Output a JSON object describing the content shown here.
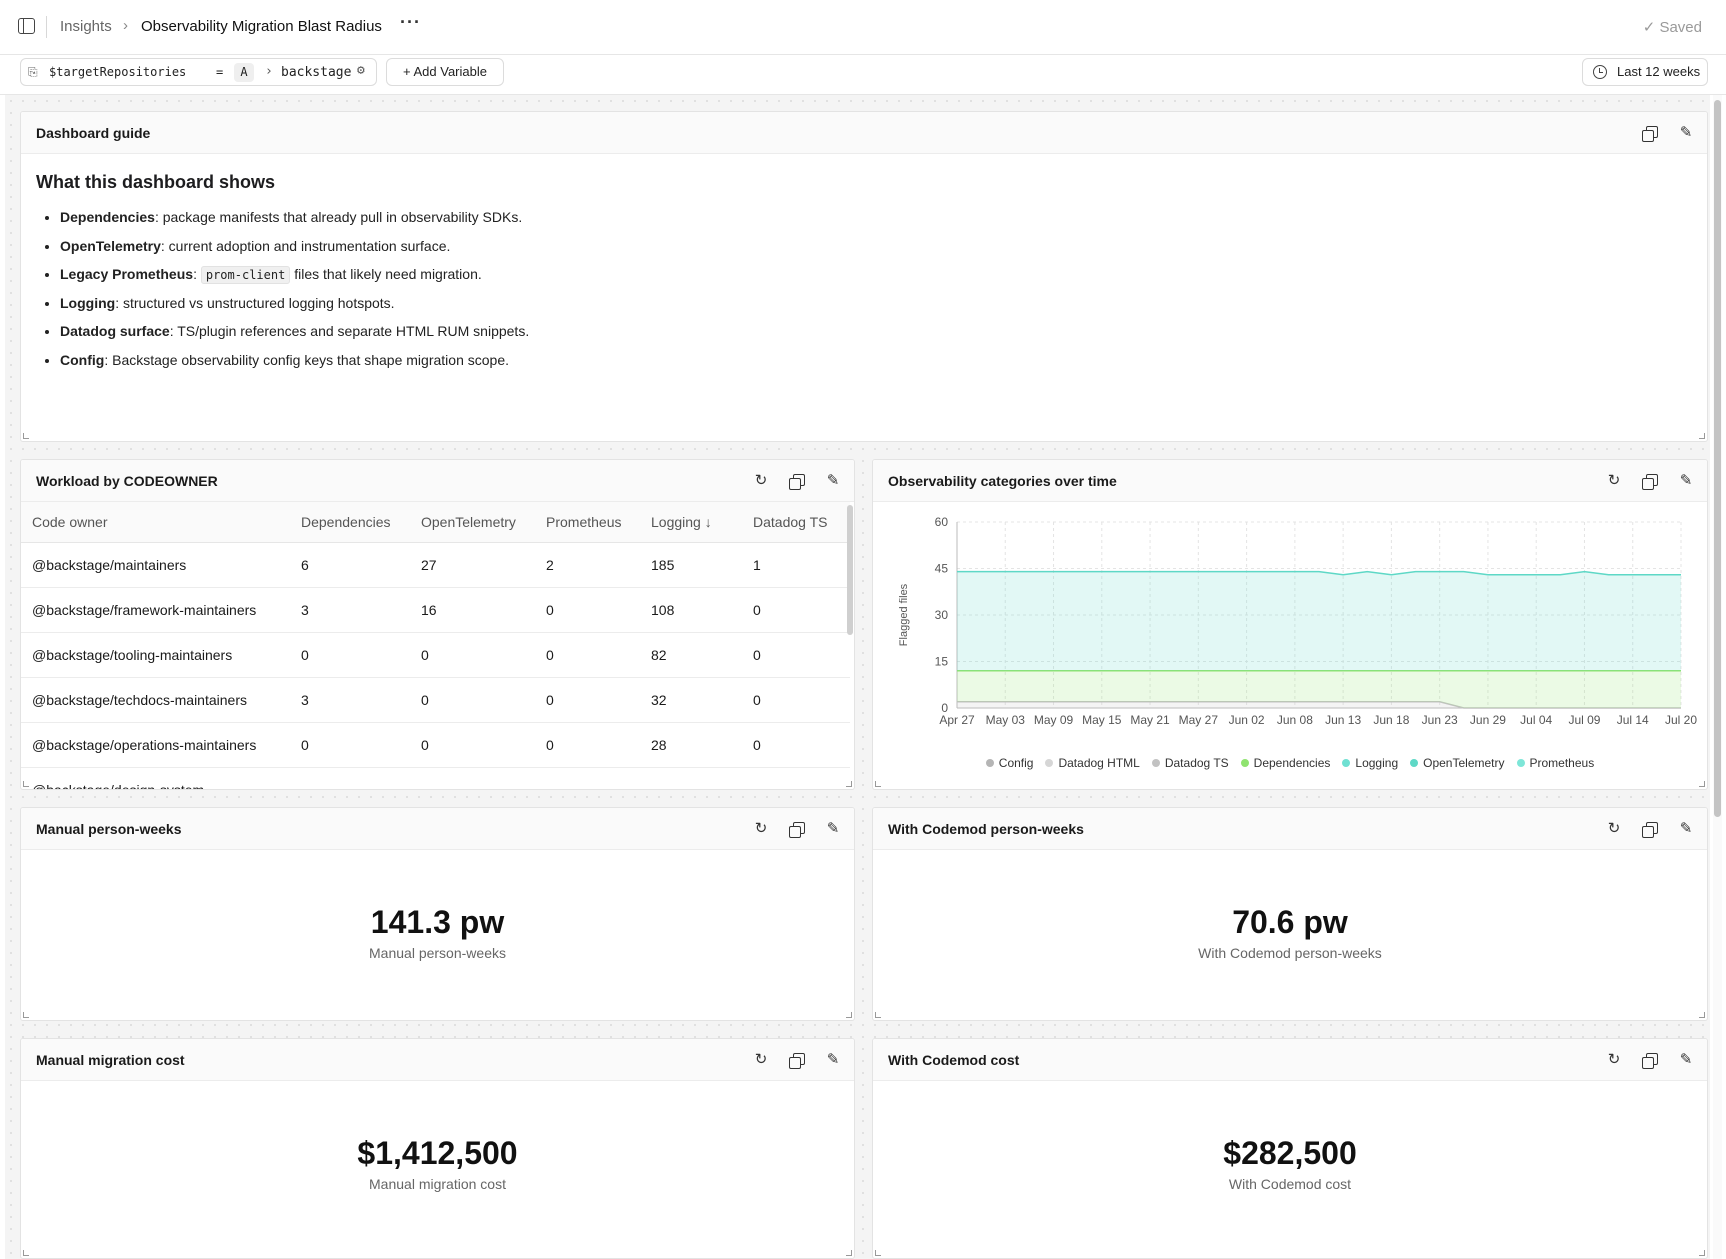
{
  "header": {
    "breadcrumb_root": "Insights",
    "breadcrumb_sep": "›",
    "title": "Observability Migration Blast Radius",
    "more": "···",
    "saved": "✓ Saved"
  },
  "variables": {
    "name": "$targetRepositories",
    "operator": "=",
    "mode": "A",
    "arrow": "›",
    "value": "backstage",
    "add_label": "+ Add Variable",
    "time_range": "Last 12 weeks"
  },
  "guide": {
    "title": "Dashboard guide",
    "heading": "What this dashboard shows",
    "items": [
      {
        "bold": "Dependencies",
        "pre": "",
        "code": "",
        "text": ": package manifests that already pull in observability SDKs."
      },
      {
        "bold": "OpenTelemetry",
        "pre": "",
        "code": "",
        "text": ": current adoption and instrumentation surface."
      },
      {
        "bold": "Legacy Prometheus",
        "pre": ": ",
        "code": "prom-client",
        "text": " files that likely need migration."
      },
      {
        "bold": "Logging",
        "pre": "",
        "code": "",
        "text": ": structured vs unstructured logging hotspots."
      },
      {
        "bold": "Datadog surface",
        "pre": "",
        "code": "",
        "text": ": TS/plugin references and separate HTML RUM snippets."
      },
      {
        "bold": "Config",
        "pre": "",
        "code": "",
        "text": ": Backstage observability config keys that shape migration scope."
      }
    ]
  },
  "workload": {
    "title": "Workload by CODEOWNER",
    "columns": [
      "Code owner",
      "Dependencies",
      "OpenTelemetry",
      "Prometheus",
      "Logging ↓",
      "Datadog TS"
    ],
    "rows": [
      [
        "@backstage/maintainers",
        "6",
        "27",
        "2",
        "185",
        "1"
      ],
      [
        "@backstage/framework-maintainers",
        "3",
        "16",
        "0",
        "108",
        "0"
      ],
      [
        "@backstage/tooling-maintainers",
        "0",
        "0",
        "0",
        "82",
        "0"
      ],
      [
        "@backstage/techdocs-maintainers",
        "3",
        "0",
        "0",
        "32",
        "0"
      ],
      [
        "@backstage/operations-maintainers",
        "0",
        "0",
        "0",
        "28",
        "0"
      ],
      [
        "@backstage/design-system",
        "",
        "",
        "",
        "",
        ""
      ]
    ]
  },
  "chart_card": {
    "title": "Observability categories over time"
  },
  "chart_data": {
    "type": "area",
    "stacked": true,
    "ylabel": "Flagged files",
    "ylim": [
      0,
      60
    ],
    "yticks": [
      0,
      15,
      30,
      45,
      60
    ],
    "x": [
      "Apr 27",
      "Apr 30",
      "May 03",
      "May 06",
      "May 09",
      "May 12",
      "May 15",
      "May 18",
      "May 21",
      "May 24",
      "May 27",
      "May 30",
      "Jun 02",
      "Jun 05",
      "Jun 08",
      "Jun 11",
      "Jun 13",
      "Jun 16",
      "Jun 18",
      "Jun 21",
      "Jun 23",
      "Jun 26",
      "Jun 29",
      "Jul 02",
      "Jul 04",
      "Jul 07",
      "Jul 09",
      "Jul 12",
      "Jul 14",
      "Jul 17",
      "Jul 20"
    ],
    "xtick_labels": [
      "Apr 27",
      "May 03",
      "May 09",
      "May 15",
      "May 21",
      "May 27",
      "Jun 02",
      "Jun 08",
      "Jun 13",
      "Jun 18",
      "Jun 23",
      "Jun 29",
      "Jul 04",
      "Jul 09",
      "Jul 14",
      "Jul 20"
    ],
    "grid": true,
    "legend_position": "bottom",
    "series": [
      {
        "name": "Config",
        "color": "#b5b5b5",
        "values": [
          0,
          0,
          0,
          0,
          0,
          0,
          0,
          0,
          0,
          0,
          0,
          0,
          0,
          0,
          0,
          0,
          0,
          0,
          0,
          0,
          0,
          0,
          0,
          0,
          0,
          0,
          0,
          0,
          0,
          0,
          0
        ]
      },
      {
        "name": "Datadog HTML",
        "color": "#d6d6d6",
        "values": [
          0,
          0,
          0,
          0,
          0,
          0,
          0,
          0,
          0,
          0,
          0,
          0,
          0,
          0,
          0,
          0,
          0,
          0,
          0,
          0,
          0,
          0,
          0,
          0,
          0,
          0,
          0,
          0,
          0,
          0,
          0
        ]
      },
      {
        "name": "Datadog TS",
        "color": "#c2c2c2",
        "values": [
          2,
          2,
          2,
          2,
          2,
          2,
          2,
          2,
          2,
          2,
          2,
          2,
          2,
          2,
          2,
          2,
          2,
          2,
          2,
          2,
          2,
          0,
          0,
          0,
          0,
          0,
          0,
          0,
          0,
          0,
          0
        ]
      },
      {
        "name": "Dependencies",
        "color": "#8fe36f",
        "values": [
          10,
          10,
          10,
          10,
          10,
          10,
          10,
          10,
          10,
          10,
          10,
          10,
          10,
          10,
          10,
          10,
          10,
          10,
          10,
          10,
          10,
          12,
          12,
          12,
          12,
          12,
          12,
          12,
          12,
          12,
          12
        ]
      },
      {
        "name": "Logging",
        "color": "#6fe0d2",
        "values": [
          0,
          0,
          0,
          0,
          0,
          0,
          0,
          0,
          0,
          0,
          0,
          0,
          0,
          0,
          0,
          0,
          0,
          0,
          0,
          0,
          0,
          0,
          0,
          0,
          0,
          0,
          0,
          0,
          0,
          0,
          0
        ]
      },
      {
        "name": "OpenTelemetry",
        "color": "#5ed8c6",
        "values": [
          32,
          32,
          32,
          32,
          32,
          32,
          32,
          32,
          32,
          32,
          32,
          32,
          32,
          32,
          32,
          32,
          31,
          32,
          31,
          32,
          32,
          32,
          31,
          31,
          31,
          31,
          32,
          31,
          31,
          31,
          31
        ]
      },
      {
        "name": "Prometheus",
        "color": "#7ee6d8",
        "values": [
          0,
          0,
          0,
          0,
          0,
          0,
          0,
          0,
          0,
          0,
          0,
          0,
          0,
          0,
          0,
          0,
          0,
          0,
          0,
          0,
          0,
          0,
          0,
          0,
          0,
          0,
          0,
          0,
          0,
          0,
          0
        ]
      }
    ]
  },
  "stats": [
    {
      "title": "Manual person-weeks",
      "value": "141.3 pw",
      "label": "Manual person-weeks"
    },
    {
      "title": "With Codemod person-weeks",
      "value": "70.6 pw",
      "label": "With Codemod person-weeks"
    },
    {
      "title": "Manual migration cost",
      "value": "$1,412,500",
      "label": "Manual migration cost"
    },
    {
      "title": "With Codemod cost",
      "value": "$282,500",
      "label": "With Codemod cost"
    }
  ],
  "icons": {
    "refresh": "↻",
    "edit": "✎",
    "gear": "⚙",
    "variable": "⎘"
  },
  "colors": {
    "accent_teal": "#5ed8c6",
    "accent_green": "#8fe36f"
  }
}
